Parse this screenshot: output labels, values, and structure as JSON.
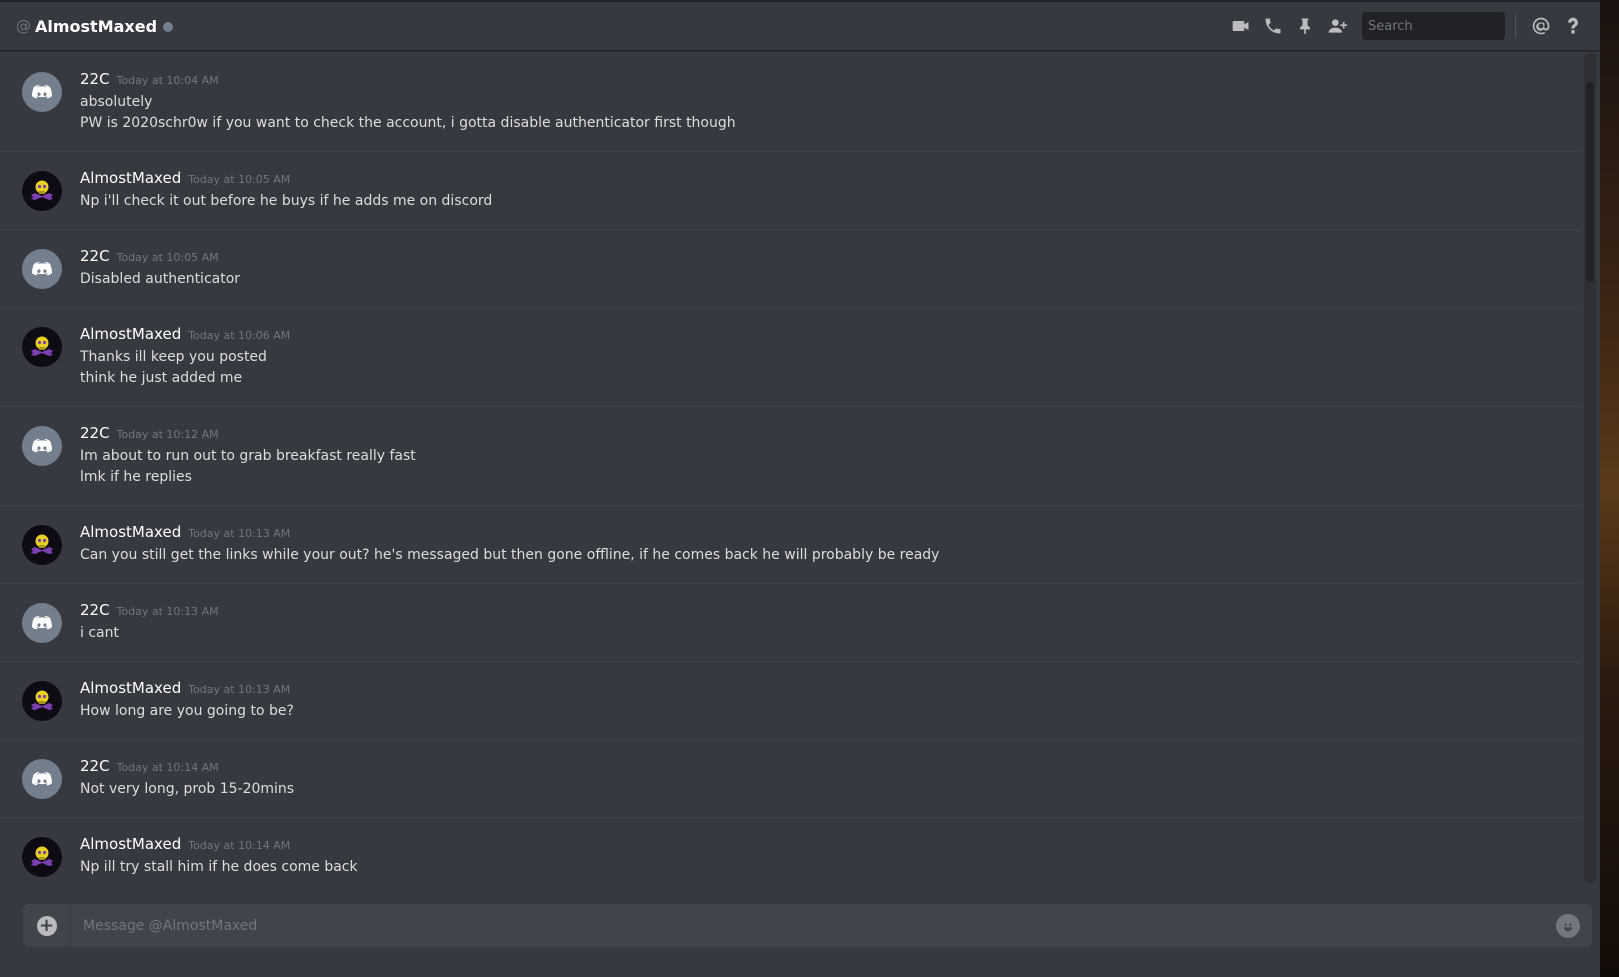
{
  "header": {
    "at_symbol": "@",
    "channel_name": "AlmostMaxed",
    "status_color": "#747f8d",
    "search_placeholder": "Search",
    "icons": [
      "video-call-icon",
      "voice-call-icon",
      "pin-icon",
      "add-friend-icon",
      "search-icon",
      "mention-icon",
      "help-icon"
    ]
  },
  "colors": {
    "background": "#36393f",
    "header_border": "#26282c",
    "composer_bg": "#40444b",
    "username": "#ffffff",
    "timestamp": "#72767d",
    "text": "#dcddde",
    "discord_avatar": "#747f8d",
    "skull_purple": "#7b3fb0",
    "skull_yellow": "#e8d21f"
  },
  "messages": [
    {
      "author": "22C",
      "avatar": "discord-default-avatar",
      "time": "Today at 10:04 AM",
      "lines": [
        "absolutely",
        "PW is 2020schr0w if you want to check the account, i gotta disable authenticator first though"
      ]
    },
    {
      "author": "AlmostMaxed",
      "avatar": "skull-avatar",
      "time": "Today at 10:05 AM",
      "lines": [
        "Np i'll check it out before he buys if he adds me on discord"
      ]
    },
    {
      "author": "22C",
      "avatar": "discord-default-avatar",
      "time": "Today at 10:05 AM",
      "lines": [
        "Disabled authenticator"
      ]
    },
    {
      "author": "AlmostMaxed",
      "avatar": "skull-avatar",
      "time": "Today at 10:06 AM",
      "lines": [
        "Thanks ill keep you posted",
        "think he just added me"
      ]
    },
    {
      "author": "22C",
      "avatar": "discord-default-avatar",
      "time": "Today at 10:12 AM",
      "lines": [
        "Im about to run out to grab breakfast really fast",
        "lmk if he replies"
      ]
    },
    {
      "author": "AlmostMaxed",
      "avatar": "skull-avatar",
      "time": "Today at 10:13 AM",
      "lines": [
        "Can you still get the links while your out? he's messaged but then gone offline, if he comes back he will probably be ready"
      ]
    },
    {
      "author": "22C",
      "avatar": "discord-default-avatar",
      "time": "Today at 10:13 AM",
      "lines": [
        "i cant"
      ]
    },
    {
      "author": "AlmostMaxed",
      "avatar": "skull-avatar",
      "time": "Today at 10:13 AM",
      "lines": [
        "How long are you going to be?"
      ]
    },
    {
      "author": "22C",
      "avatar": "discord-default-avatar",
      "time": "Today at 10:14 AM",
      "lines": [
        "Not very long, prob 15-20mins"
      ]
    },
    {
      "author": "AlmostMaxed",
      "avatar": "skull-avatar",
      "time": "Today at 10:14 AM",
      "lines": [
        "Np ill try stall him if he does come back"
      ]
    }
  ],
  "composer": {
    "placeholder": "Message @AlmostMaxed",
    "attach_symbol": "+",
    "attach_icon": "plus-circle-icon",
    "emoji_icon": "emoji-icon"
  }
}
